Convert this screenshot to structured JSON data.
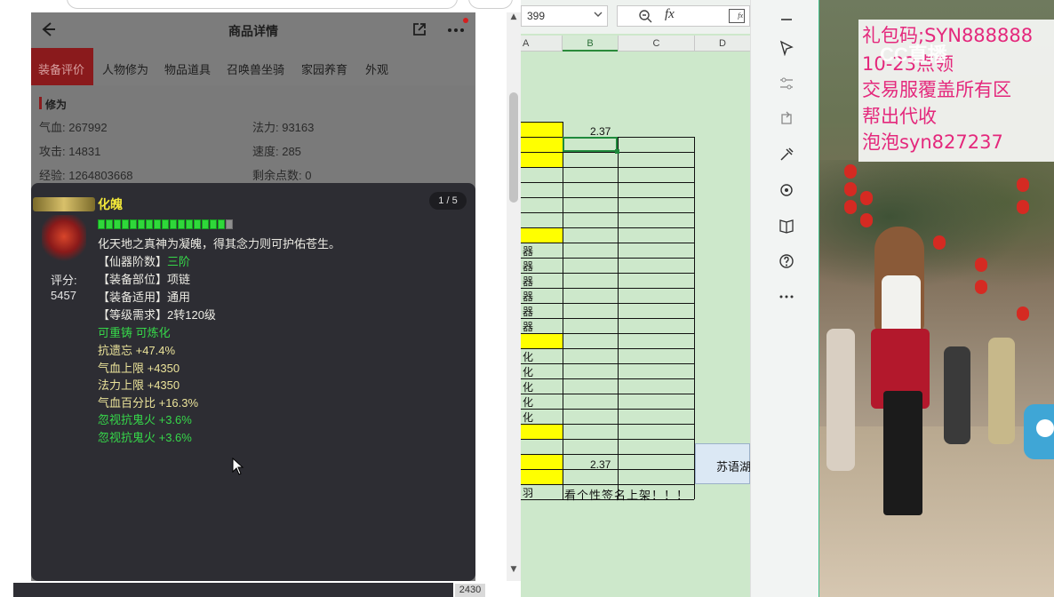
{
  "game_panel": {
    "title": "商品详情",
    "tabs": [
      "装备评价",
      "人物修为",
      "物品道具",
      "召唤兽坐骑",
      "家园养育",
      "外观"
    ],
    "section_title": "修为",
    "stats": [
      {
        "label": "气血: 267992"
      },
      {
        "label": "法力: 93163"
      },
      {
        "label": "攻击: 14831"
      },
      {
        "label": "速度: 285"
      },
      {
        "label": "经验: 1264803668"
      },
      {
        "label": "剩余点数: 0"
      }
    ],
    "tooltip": {
      "item_name": "化魄",
      "page_indicator": "1 / 5",
      "durability": {
        "filled": 16,
        "total": 17
      },
      "description": "化天地之真神为凝魄，得其念力则可护佑苍生。",
      "attributes": [
        {
          "key": "【仙器阶数】",
          "value": "三阶"
        },
        {
          "key": "【装备部位】",
          "value": "项链"
        },
        {
          "key": "【装备适用】",
          "value": "通用"
        },
        {
          "key": "【等级需求】",
          "value": "2转120级"
        }
      ],
      "recast_line": "可重铸 可炼化",
      "bonus_lines": [
        "抗遗忘 +47.4%",
        "气血上限 +4350",
        "法力上限 +4350",
        "气血百分比 +16.3%"
      ],
      "green_lines": [
        "忽视抗鬼火 +3.6%",
        "忽视抗鬼火 +3.6%"
      ],
      "score_label": "评分:",
      "score_value": "5457"
    },
    "bottom_number": "2430"
  },
  "spreadsheet": {
    "namebox_value": "399",
    "fx_label": "fx",
    "columns": [
      "A",
      "B",
      "C",
      "D"
    ],
    "b_value_top": "2.37",
    "b_value_bottom": "2.37",
    "a_column_fragments": [
      {
        "row": 8,
        "text": "器"
      },
      {
        "row": 9,
        "text": "器"
      },
      {
        "row": 10,
        "text": "器"
      },
      {
        "row": 11,
        "text": "器"
      },
      {
        "row": 12,
        "text": "器"
      },
      {
        "row": 13,
        "text": "器"
      },
      {
        "row": 15,
        "text": "化"
      },
      {
        "row": 16,
        "text": "化"
      },
      {
        "row": 17,
        "text": "化"
      },
      {
        "row": 18,
        "text": "化"
      },
      {
        "row": 19,
        "text": "化"
      },
      {
        "row": 24,
        "text": "羽"
      }
    ],
    "d_cell_text": "苏语湖",
    "footer_text": "看个性签名上架！！！"
  },
  "live_video": {
    "overlay_lines": [
      "礼包码;SYN888888",
      "10-23点领",
      "交易服覆盖所有区",
      "帮出代收",
      "泡泡syn827237"
    ],
    "watermark": "CC直播"
  },
  "colors": {
    "accent_red": "#8a1a1c",
    "tooltip_bg": "#2d2d33",
    "item_name_yellow": "#f2e83a",
    "green_text": "#36d84a",
    "sheet_bg": "#cde8cb",
    "sheet_yellow": "#ffff00",
    "overlay_pink": "#e4287c"
  },
  "icons": [
    "back-arrow-icon",
    "share-icon",
    "more-icon",
    "dropdown-chevron-icon",
    "zoom-icon",
    "fx-icon",
    "minimize-icon",
    "select-cursor-icon",
    "adjust-icon",
    "rotate-icon",
    "tools-icon",
    "settings-icon",
    "book-icon",
    "help-icon",
    "more-dots-icon"
  ]
}
